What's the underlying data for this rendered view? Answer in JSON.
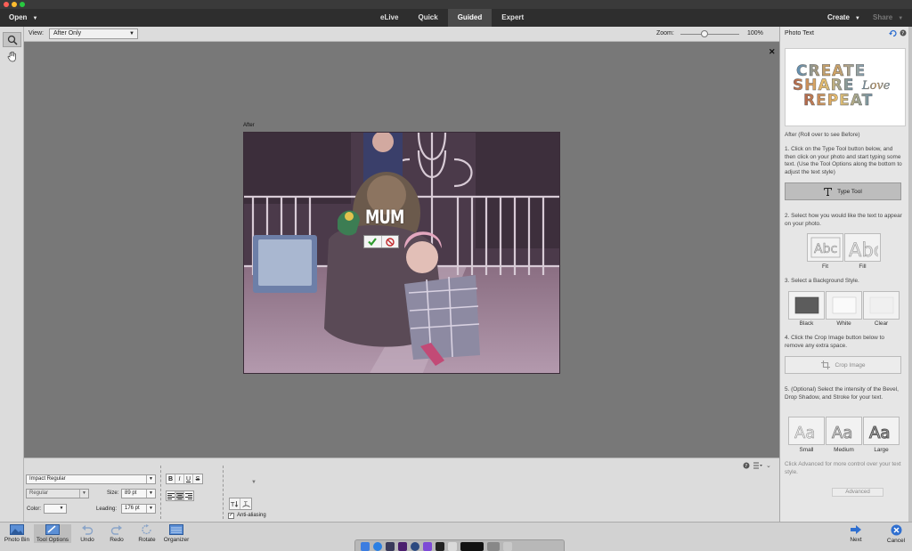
{
  "menubar": {
    "open_label": "Open",
    "mode_tabs": [
      {
        "label": "eLive",
        "active": false
      },
      {
        "label": "Quick",
        "active": false
      },
      {
        "label": "Guided",
        "active": true
      },
      {
        "label": "Expert",
        "active": false
      }
    ],
    "create_label": "Create",
    "share_label": "Share"
  },
  "toolbox": {
    "tools": [
      {
        "name": "zoom-tool-icon",
        "active": true
      },
      {
        "name": "hand-tool-icon",
        "active": false
      }
    ]
  },
  "view_options": {
    "view_label": "View:",
    "view_value": "After Only",
    "zoom_label": "Zoom:",
    "zoom_value": "100%"
  },
  "canvas": {
    "after_label": "After",
    "photo_text": "MUM"
  },
  "tool_options": {
    "font_family": "Impact Regular",
    "font_style": "Regular",
    "size_label": "Size:",
    "size_value": "89 pt",
    "leading_label": "Leading:",
    "leading_value": "176 pt",
    "color_label": "Color:",
    "anti_aliasing_label": "Anti-aliasing",
    "anti_aliasing_checked": true,
    "style_buttons": [
      "B",
      "I",
      "U",
      "S"
    ]
  },
  "guided_panel": {
    "title": "Photo Text",
    "thumbnail_alt": "CREATE SHARE LOVE REPEAT",
    "after_note": "After (Roll over to see Before)",
    "step1": "1. Click on the Type Tool button below, and then click on your photo and start typing some text. (Use the Tool Options along the bottom to adjust the text style)",
    "type_tool_label": "Type Tool",
    "step2": "2. Select how you would like the text to appear on your photo.",
    "appearance_options": [
      "Fit",
      "Fill"
    ],
    "step3": "3. Select a Background Style.",
    "background_options": [
      "Black",
      "White",
      "Clear"
    ],
    "step4": "4. Click the Crop Image button below to remove any extra space.",
    "crop_label": "Crop Image",
    "step5": "5. (Optional) Select the intensity of the Bevel, Drop Shadow, and Stroke for your text.",
    "intensity_options": [
      "Small",
      "Medium",
      "Large"
    ],
    "advanced_note": "Click Advanced for more control over your text style.",
    "advanced_label": "Advanced"
  },
  "taskbar": {
    "left_buttons": [
      {
        "label": "Photo Bin",
        "icon": "photo-bin-icon"
      },
      {
        "label": "Tool Options",
        "icon": "tool-options-icon"
      },
      {
        "label": "Undo",
        "icon": "undo-icon"
      },
      {
        "label": "Redo",
        "icon": "redo-icon"
      },
      {
        "label": "Rotate",
        "icon": "rotate-icon"
      },
      {
        "label": "Organizer",
        "icon": "organizer-icon"
      }
    ],
    "next_label": "Next",
    "cancel_label": "Cancel"
  },
  "colors": {
    "active_tab_bg": "#4a4a4a",
    "menubar_bg": "#2e2e2e",
    "canvas_bg": "#787878",
    "panel_bg": "#e6e6e6",
    "next_icon": "#2f6fd0",
    "commit_check": "#2e9a2e",
    "commit_cancel": "#c0282a"
  }
}
